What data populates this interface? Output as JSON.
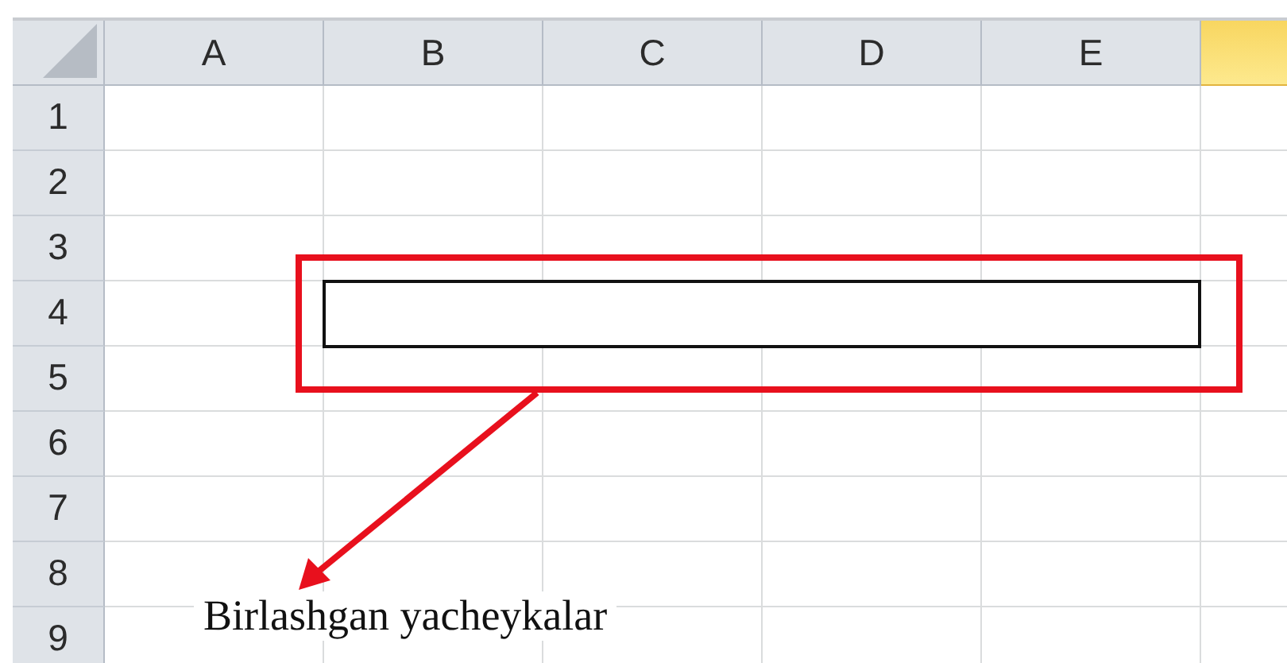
{
  "sheet": {
    "columns": [
      {
        "label": "A",
        "selected": false
      },
      {
        "label": "B",
        "selected": false
      },
      {
        "label": "C",
        "selected": false
      },
      {
        "label": "D",
        "selected": false
      },
      {
        "label": "E",
        "selected": false
      },
      {
        "selected": true
      }
    ],
    "rows": [
      {
        "label": "1"
      },
      {
        "label": "2"
      },
      {
        "label": "3"
      },
      {
        "label": "4"
      },
      {
        "label": "5"
      },
      {
        "label": "6"
      },
      {
        "label": "7"
      },
      {
        "label": "8"
      },
      {
        "label": "9"
      }
    ]
  },
  "annotation": {
    "label": "Birlashgan yacheykalar"
  }
}
